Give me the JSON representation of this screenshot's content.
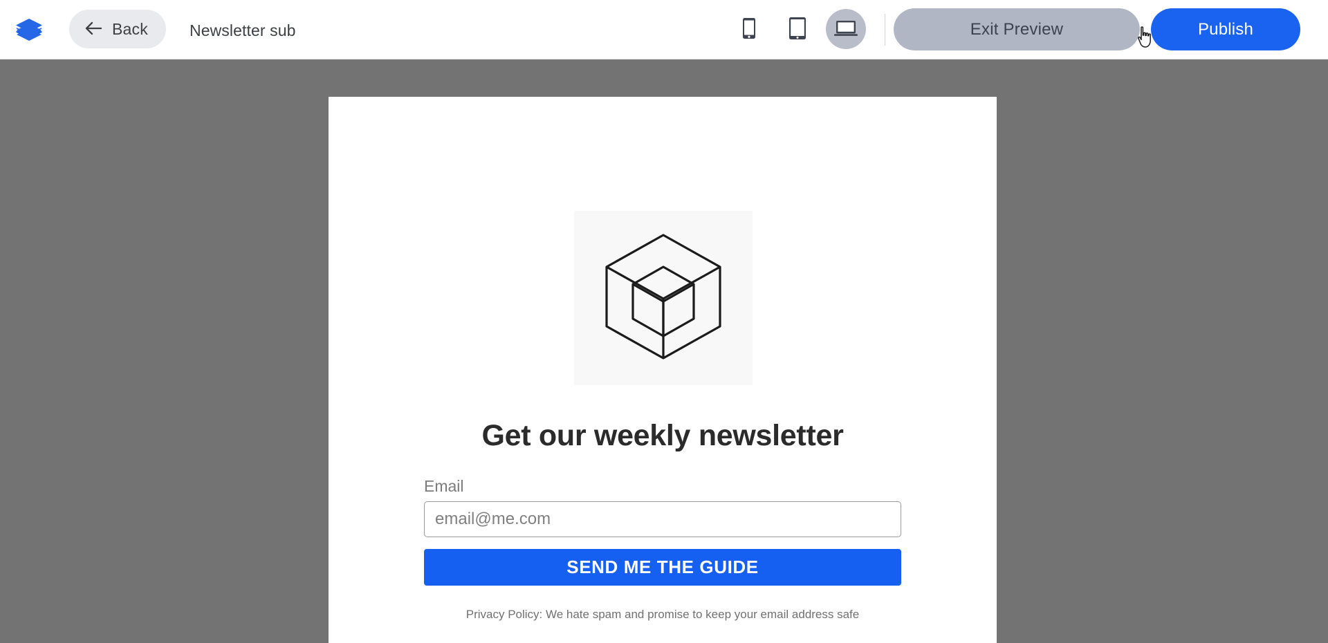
{
  "toolbar": {
    "logo_icon": "stacked-layers-logo",
    "back_label": "Back",
    "back_icon": "arrow-left-icon",
    "document_title": "Newsletter sub",
    "devices": [
      {
        "name": "mobile",
        "icon": "mobile-phone-icon",
        "active": false
      },
      {
        "name": "tablet",
        "icon": "tablet-icon",
        "active": false
      },
      {
        "name": "desktop",
        "icon": "laptop-desktop-icon",
        "active": true
      }
    ],
    "exit_preview_label": "Exit Preview",
    "publish_label": "Publish",
    "accent_color": "#1a63f0",
    "exit_button_color": "#b0b6c4",
    "back_button_color": "#e8eaed"
  },
  "canvas": {
    "backdrop_color": "#737373",
    "page_background": "#ffffff"
  },
  "page": {
    "hero_image_alt": "isometric-cube-illustration",
    "hero_image_background": "#f8f8f8",
    "headline": "Get our weekly newsletter",
    "form": {
      "email_label": "Email",
      "email_value": "",
      "email_placeholder": "email@me.com",
      "submit_label": "SEND ME THE GUIDE",
      "submit_color": "#1560f0"
    },
    "privacy_note": "Privacy Policy: We hate spam and promise to keep your email address safe"
  },
  "cursor": {
    "type": "pointer-hand-cursor"
  }
}
